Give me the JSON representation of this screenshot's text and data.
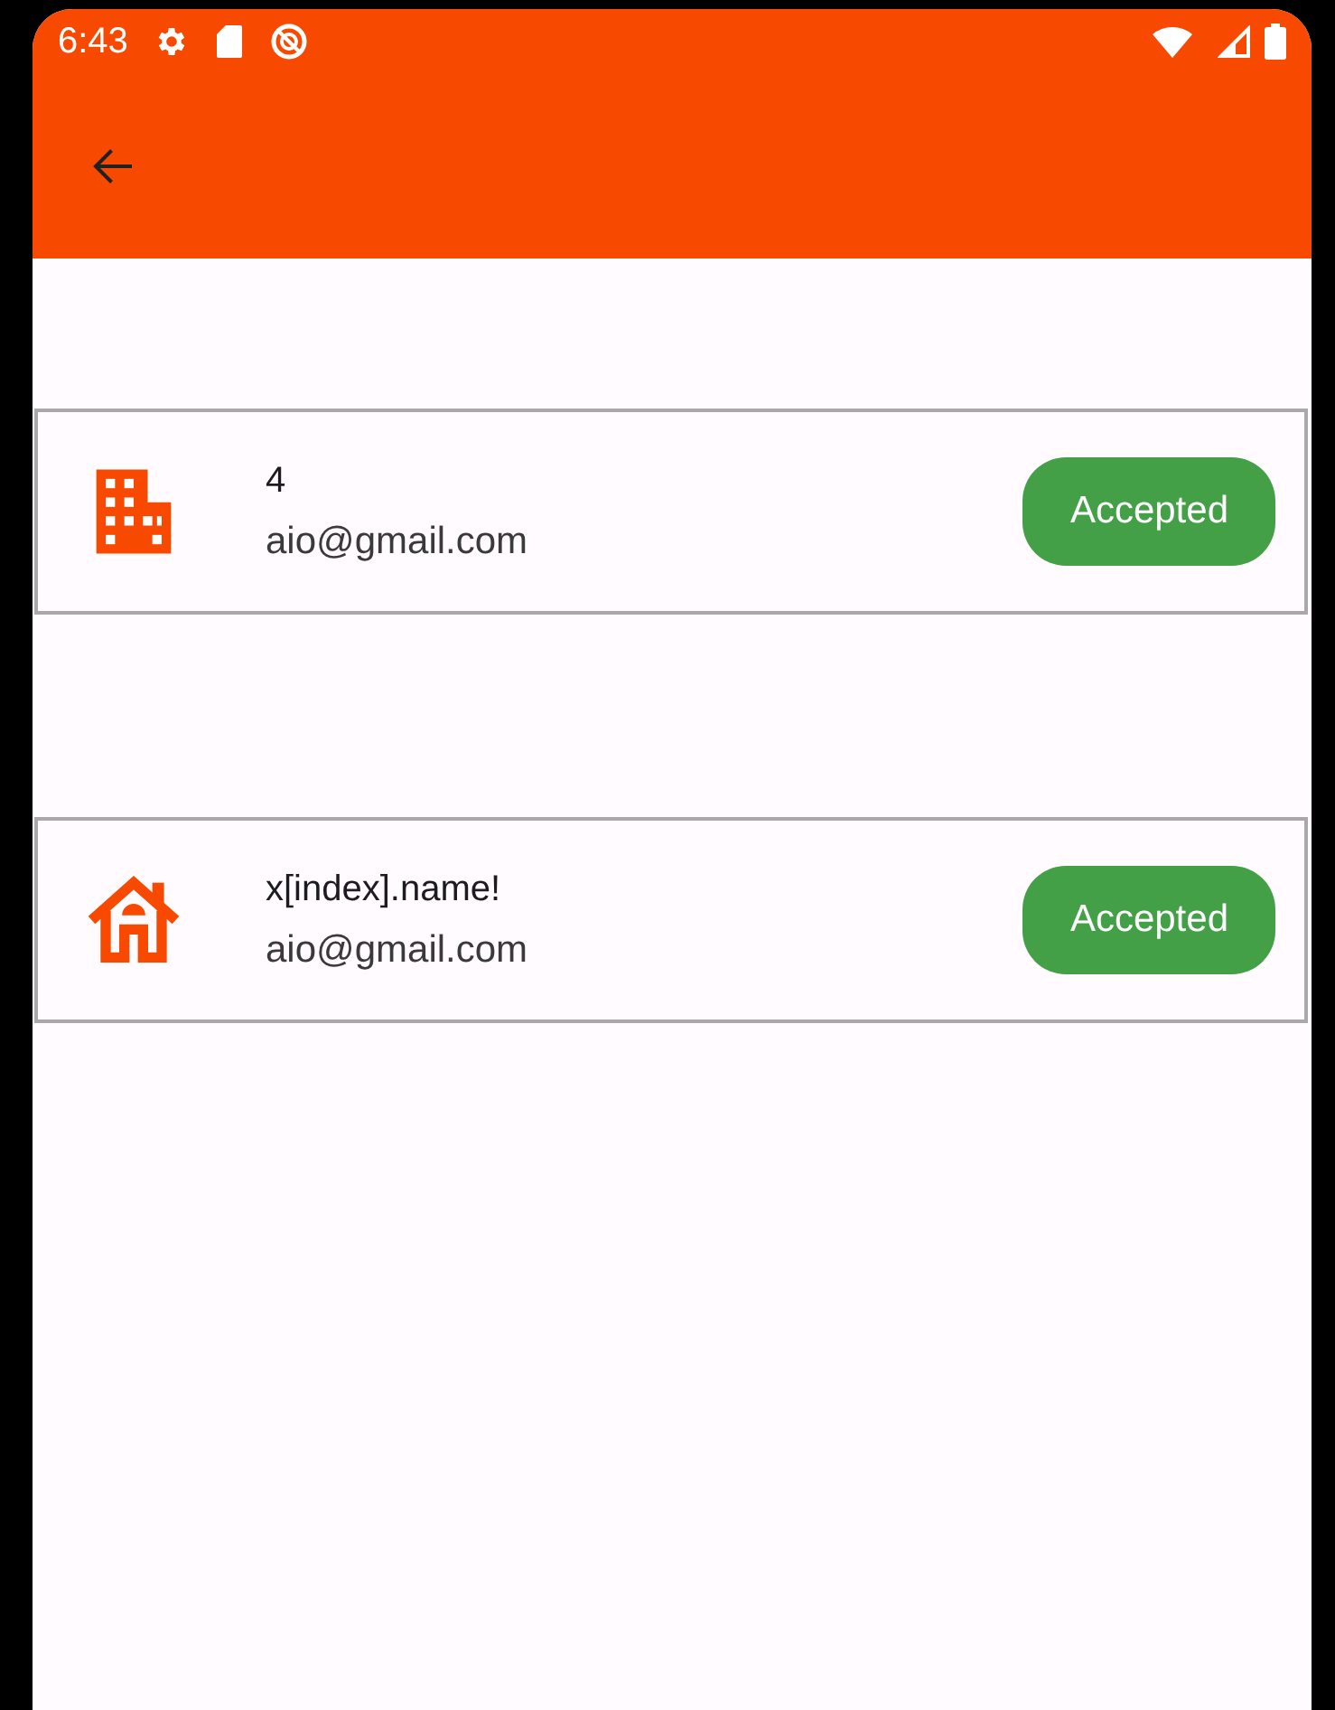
{
  "status_bar": {
    "time": "6:43"
  },
  "items": [
    {
      "kind": "building",
      "title": "4",
      "email": "aio@gmail.com",
      "status": "Accepted"
    },
    {
      "kind": "house",
      "title": "x[index].name!",
      "email": "aio@gmail.com",
      "status": "Accepted"
    }
  ]
}
